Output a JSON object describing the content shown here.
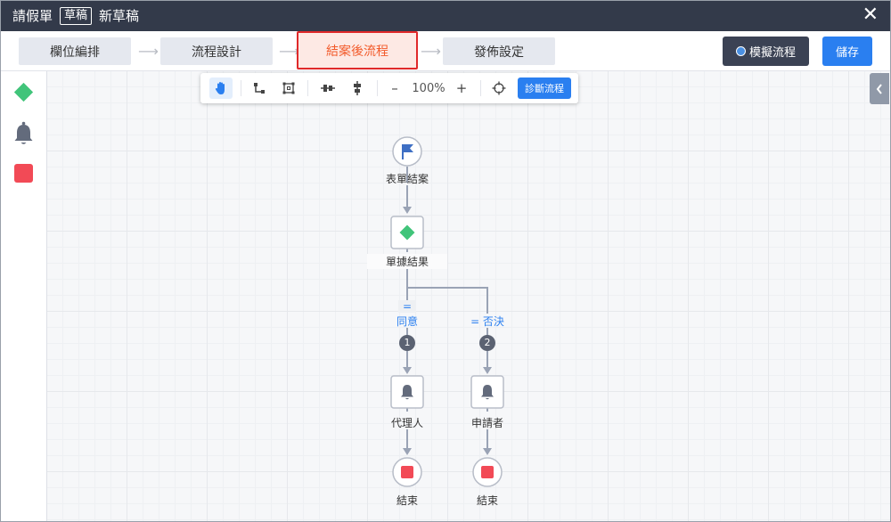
{
  "header": {
    "title": "請假單",
    "draft_badge": "草稿",
    "draft_name": "新草稿",
    "close_glyph": "✕"
  },
  "steps": [
    {
      "label": "欄位編排",
      "active": false
    },
    {
      "label": "流程設計",
      "active": false
    },
    {
      "label": "結案後流程",
      "active": true
    },
    {
      "label": "發佈設定",
      "active": false
    }
  ],
  "actions": {
    "simulate": "模擬流程",
    "save": "儲存"
  },
  "toolbar": {
    "zoom": "100%",
    "zoom_out": "–",
    "zoom_in": "+",
    "diagnose": "診斷流程"
  },
  "palette": [
    {
      "icon": "diamond-icon",
      "color": "#41c47a"
    },
    {
      "icon": "bell-icon",
      "color": "#636b7c"
    },
    {
      "icon": "stop-icon",
      "color": "#f24a56"
    }
  ],
  "flow": {
    "start_label": "表單結案",
    "decision_label": "單據結果",
    "branch_left": {
      "eq": "=",
      "cond": "同意",
      "num": "1",
      "node_label": "代理人",
      "end_label": "結束"
    },
    "branch_right": {
      "cond": "= 否決",
      "num": "2",
      "node_label": "申請者",
      "end_label": "結束"
    }
  },
  "colors": {
    "accent": "#2a7ff0",
    "active_step": "#e0292a",
    "header": "#333a4a",
    "diamond": "#41c47a",
    "stop": "#f24a56",
    "flag": "#3e6fc4"
  }
}
